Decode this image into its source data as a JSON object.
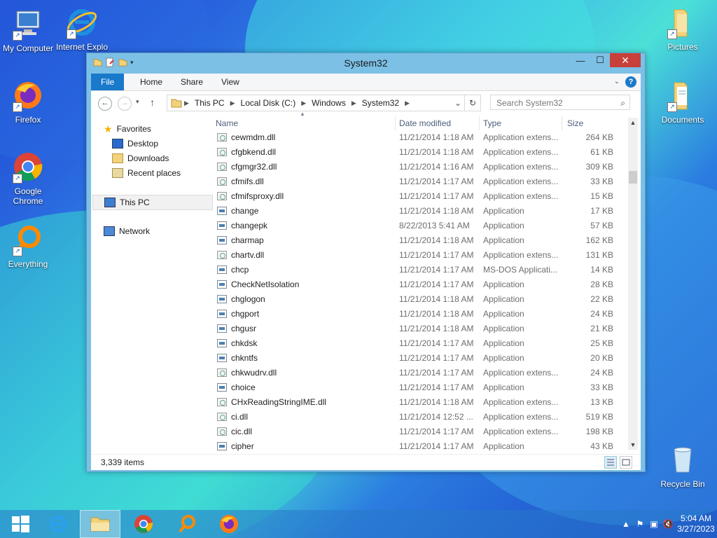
{
  "desktop": {
    "icons": [
      {
        "label": "My Computer"
      },
      {
        "label": "Internet Explo"
      },
      {
        "label": "Firefox"
      },
      {
        "label": "Google Chrome"
      },
      {
        "label": "Everything"
      },
      {
        "label": "Pictures"
      },
      {
        "label": "Documents"
      },
      {
        "label": "Recycle Bin"
      }
    ]
  },
  "window": {
    "title": "System32",
    "ribbon": {
      "file": "File",
      "home": "Home",
      "share": "Share",
      "view": "View"
    },
    "address": {
      "this_pc": "This PC",
      "local_disk": "Local Disk (C:)",
      "windows": "Windows",
      "system32": "System32"
    },
    "search_placeholder": "Search System32",
    "nav": {
      "favorites": "Favorites",
      "desktop": "Desktop",
      "downloads": "Downloads",
      "recent": "Recent places",
      "this_pc": "This PC",
      "network": "Network"
    },
    "columns": {
      "name": "Name",
      "date": "Date modified",
      "type": "Type",
      "size": "Size"
    },
    "files": [
      {
        "name": "cewmdm.dll",
        "date": "11/21/2014 1:18 AM",
        "type": "Application extens...",
        "size": "264 KB"
      },
      {
        "name": "cfgbkend.dll",
        "date": "11/21/2014 1:18 AM",
        "type": "Application extens...",
        "size": "61 KB"
      },
      {
        "name": "cfgmgr32.dll",
        "date": "11/21/2014 1:16 AM",
        "type": "Application extens...",
        "size": "309 KB"
      },
      {
        "name": "cfmifs.dll",
        "date": "11/21/2014 1:17 AM",
        "type": "Application extens...",
        "size": "33 KB"
      },
      {
        "name": "cfmifsproxy.dll",
        "date": "11/21/2014 1:17 AM",
        "type": "Application extens...",
        "size": "15 KB"
      },
      {
        "name": "change",
        "date": "11/21/2014 1:18 AM",
        "type": "Application",
        "size": "17 KB"
      },
      {
        "name": "changepk",
        "date": "8/22/2013 5:41 AM",
        "type": "Application",
        "size": "57 KB"
      },
      {
        "name": "charmap",
        "date": "11/21/2014 1:18 AM",
        "type": "Application",
        "size": "162 KB"
      },
      {
        "name": "chartv.dll",
        "date": "11/21/2014 1:17 AM",
        "type": "Application extens...",
        "size": "131 KB"
      },
      {
        "name": "chcp",
        "date": "11/21/2014 1:17 AM",
        "type": "MS-DOS Applicati...",
        "size": "14 KB"
      },
      {
        "name": "CheckNetIsolation",
        "date": "11/21/2014 1:17 AM",
        "type": "Application",
        "size": "28 KB"
      },
      {
        "name": "chglogon",
        "date": "11/21/2014 1:18 AM",
        "type": "Application",
        "size": "22 KB"
      },
      {
        "name": "chgport",
        "date": "11/21/2014 1:18 AM",
        "type": "Application",
        "size": "24 KB"
      },
      {
        "name": "chgusr",
        "date": "11/21/2014 1:18 AM",
        "type": "Application",
        "size": "21 KB"
      },
      {
        "name": "chkdsk",
        "date": "11/21/2014 1:17 AM",
        "type": "Application",
        "size": "25 KB"
      },
      {
        "name": "chkntfs",
        "date": "11/21/2014 1:17 AM",
        "type": "Application",
        "size": "20 KB"
      },
      {
        "name": "chkwudrv.dll",
        "date": "11/21/2014 1:17 AM",
        "type": "Application extens...",
        "size": "24 KB"
      },
      {
        "name": "choice",
        "date": "11/21/2014 1:17 AM",
        "type": "Application",
        "size": "33 KB"
      },
      {
        "name": "CHxReadingStringIME.dll",
        "date": "11/21/2014 1:18 AM",
        "type": "Application extens...",
        "size": "13 KB"
      },
      {
        "name": "ci.dll",
        "date": "11/21/2014 12:52 ...",
        "type": "Application extens...",
        "size": "519 KB"
      },
      {
        "name": "cic.dll",
        "date": "11/21/2014 1:17 AM",
        "type": "Application extens...",
        "size": "198 KB"
      },
      {
        "name": "cipher",
        "date": "11/21/2014 1:17 AM",
        "type": "Application",
        "size": "43 KB"
      }
    ],
    "status_count": "3,339 items"
  },
  "taskbar": {
    "clock_time": "5:04 AM",
    "clock_date": "3/27/2023"
  }
}
